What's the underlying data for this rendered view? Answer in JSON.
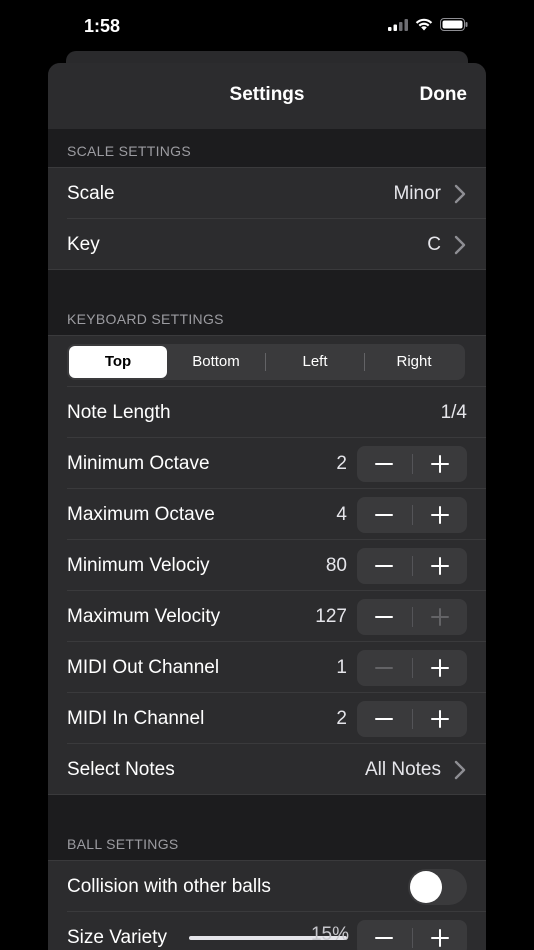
{
  "status": {
    "time": "1:58"
  },
  "nav": {
    "title": "Settings",
    "done": "Done"
  },
  "scale_section": {
    "header": "SCALE SETTINGS",
    "scale": {
      "label": "Scale",
      "value": "Minor"
    },
    "key": {
      "label": "Key",
      "value": "C"
    }
  },
  "keyboard_section": {
    "header": "KEYBOARD SETTINGS",
    "segments": [
      "Top",
      "Bottom",
      "Left",
      "Right"
    ],
    "selected_segment": "Top",
    "note_length": {
      "label": "Note Length",
      "value": "1/4"
    },
    "steppers": [
      {
        "label": "Minimum Octave",
        "value": "2",
        "minus_enabled": true,
        "plus_enabled": true
      },
      {
        "label": "Maximum Octave",
        "value": "4",
        "minus_enabled": true,
        "plus_enabled": true
      },
      {
        "label": "Minimum Velociy",
        "value": "80",
        "minus_enabled": true,
        "plus_enabled": true
      },
      {
        "label": "Maximum Velocity",
        "value": "127",
        "minus_enabled": true,
        "plus_enabled": false
      },
      {
        "label": "MIDI Out Channel",
        "value": "1",
        "minus_enabled": false,
        "plus_enabled": true
      },
      {
        "label": "MIDI In Channel",
        "value": "2",
        "minus_enabled": true,
        "plus_enabled": true
      }
    ],
    "select_notes": {
      "label": "Select Notes",
      "value": "All Notes"
    }
  },
  "ball_section": {
    "header": "BALL SETTINGS",
    "collision": {
      "label": "Collision with other balls",
      "on": false
    },
    "size_variety": {
      "label": "Size Variety",
      "value": "15%",
      "slider_fraction": 1.0
    }
  },
  "colors": {
    "accent_enabled": "#ffffff",
    "disabled": "#636366",
    "sheet_bg": "#1c1c1e",
    "row_bg": "#2c2c2e"
  }
}
